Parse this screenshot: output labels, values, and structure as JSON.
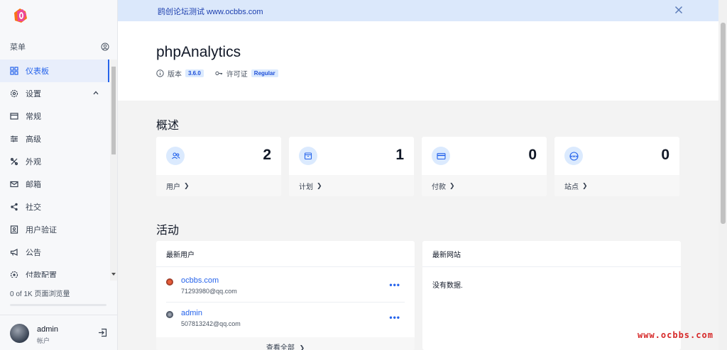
{
  "banner": {
    "text": "鸥创论坛测试 www.ocbbs.com",
    "close_icon": "close-icon"
  },
  "sidebar": {
    "menu_label": "菜单",
    "items": [
      {
        "label": "仪表板",
        "icon": "dashboard-grid-icon",
        "active": true
      },
      {
        "label": "设置",
        "icon": "settings-gear-icon",
        "expanded": true
      },
      {
        "label": "常规",
        "icon": "window-icon"
      },
      {
        "label": "高级",
        "icon": "sliders-icon"
      },
      {
        "label": "外观",
        "icon": "palette-icon"
      },
      {
        "label": "邮箱",
        "icon": "mail-icon"
      },
      {
        "label": "社交",
        "icon": "share-icon"
      },
      {
        "label": "用户验证",
        "icon": "user-badge-icon"
      },
      {
        "label": "公告",
        "icon": "megaphone-icon"
      },
      {
        "label": "付款配置",
        "icon": "gear-icon"
      }
    ],
    "usage_text": "0 of 1K 页面浏览量",
    "usage_fraction": 0,
    "user": {
      "name": "admin",
      "subtitle": "帐户"
    }
  },
  "header": {
    "title": "phpAnalytics",
    "version_label": "版本",
    "version": "3.6.0",
    "license_label": "许可证",
    "license": "Regular"
  },
  "overview": {
    "title": "概述",
    "cards": [
      {
        "label": "用户",
        "value": "2",
        "icon": "users-icon"
      },
      {
        "label": "计划",
        "value": "1",
        "icon": "package-icon"
      },
      {
        "label": "付款",
        "value": "0",
        "icon": "credit-card-icon"
      },
      {
        "label": "站点",
        "value": "0",
        "icon": "www-globe-icon"
      }
    ]
  },
  "activity": {
    "title": "活动",
    "latest_users": {
      "title": "最新用户",
      "rows": [
        {
          "name": "ocbbs.com",
          "email": "71293980@qq.com"
        },
        {
          "name": "admin",
          "email": "507813242@qq.com"
        }
      ],
      "view_all": "查看全部"
    },
    "latest_sites": {
      "title": "最新网站",
      "empty": "没有数据."
    }
  },
  "watermark": "www.ocbbs.com",
  "colors": {
    "accent": "#2563eb",
    "banner_bg": "#dbe8fb",
    "icon_bg": "#dbeafe"
  }
}
